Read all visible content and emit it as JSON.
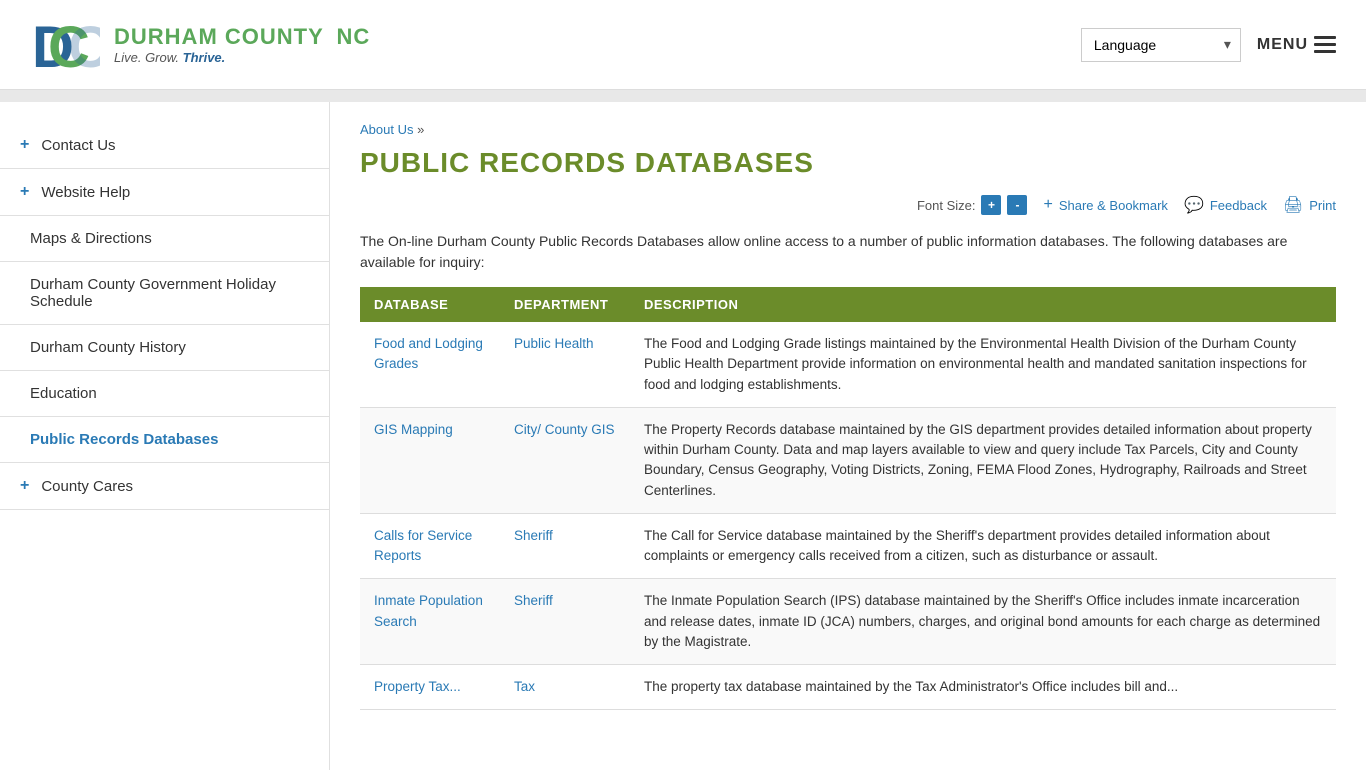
{
  "header": {
    "logo_title_part1": "DURHAM COUNTY",
    "logo_title_part2": "NC",
    "logo_subtitle": "Live. Grow. Thrive.",
    "language_label": "Language",
    "menu_label": "MENU"
  },
  "sidebar": {
    "items": [
      {
        "id": "contact-us",
        "label": "Contact Us",
        "indent": false,
        "plus": true,
        "active": false
      },
      {
        "id": "website-help",
        "label": "Website Help",
        "indent": false,
        "plus": true,
        "active": false
      },
      {
        "id": "maps-directions",
        "label": "Maps & Directions",
        "indent": true,
        "plus": false,
        "active": false
      },
      {
        "id": "holiday-schedule",
        "label": "Durham County Government Holiday Schedule",
        "indent": true,
        "plus": false,
        "active": false
      },
      {
        "id": "county-history",
        "label": "Durham County History",
        "indent": true,
        "plus": false,
        "active": false
      },
      {
        "id": "education",
        "label": "Education",
        "indent": true,
        "plus": false,
        "active": false
      },
      {
        "id": "public-records",
        "label": "Public Records Databases",
        "indent": true,
        "plus": false,
        "active": true
      },
      {
        "id": "county-cares",
        "label": "County Cares",
        "indent": false,
        "plus": true,
        "active": false
      }
    ]
  },
  "breadcrumb": {
    "parent_label": "About Us",
    "separator": "»"
  },
  "page": {
    "title": "PUBLIC RECORDS DATABASES",
    "intro": "The On-line Durham County Public Records Databases allow online access to a number of public information databases. The following databases are available for inquiry:",
    "font_size_label": "Font Size:",
    "font_increase": "+",
    "font_decrease": "-",
    "share_label": "Share & Bookmark",
    "feedback_label": "Feedback",
    "print_label": "Print"
  },
  "table": {
    "headers": [
      "DATABASE",
      "DEPARTMENT",
      "DESCRIPTION"
    ],
    "rows": [
      {
        "database": "Food and Lodging Grades",
        "department": "Public Health",
        "description": "The Food and Lodging Grade listings maintained by the Environmental Health Division of the Durham County Public Health Department provide information on environmental health and mandated sanitation inspections for food and lodging establishments."
      },
      {
        "database": "GIS Mapping",
        "department": "City/ County GIS",
        "description": "The Property Records database maintained by the GIS department provides detailed information about property within Durham County. Data and map layers available to view and query include Tax Parcels, City and County Boundary, Census Geography, Voting Districts, Zoning, FEMA Flood Zones, Hydrography, Railroads and Street Centerlines."
      },
      {
        "database": "Calls for Service Reports",
        "department": "Sheriff",
        "description": "The Call for Service database maintained by the Sheriff's department provides detailed information about complaints or emergency calls received from a citizen, such as disturbance or assault."
      },
      {
        "database": "Inmate Population Search",
        "department": "Sheriff",
        "description": "The Inmate Population Search (IPS) database maintained by the Sheriff's Office includes inmate incarceration and release dates, inmate ID (JCA) numbers, charges, and original bond amounts for each charge as determined by the Magistrate."
      },
      {
        "database": "Property Tax...",
        "department": "Tax",
        "description": "The property tax database maintained by the Tax Administrator's Office includes bill and..."
      }
    ]
  }
}
